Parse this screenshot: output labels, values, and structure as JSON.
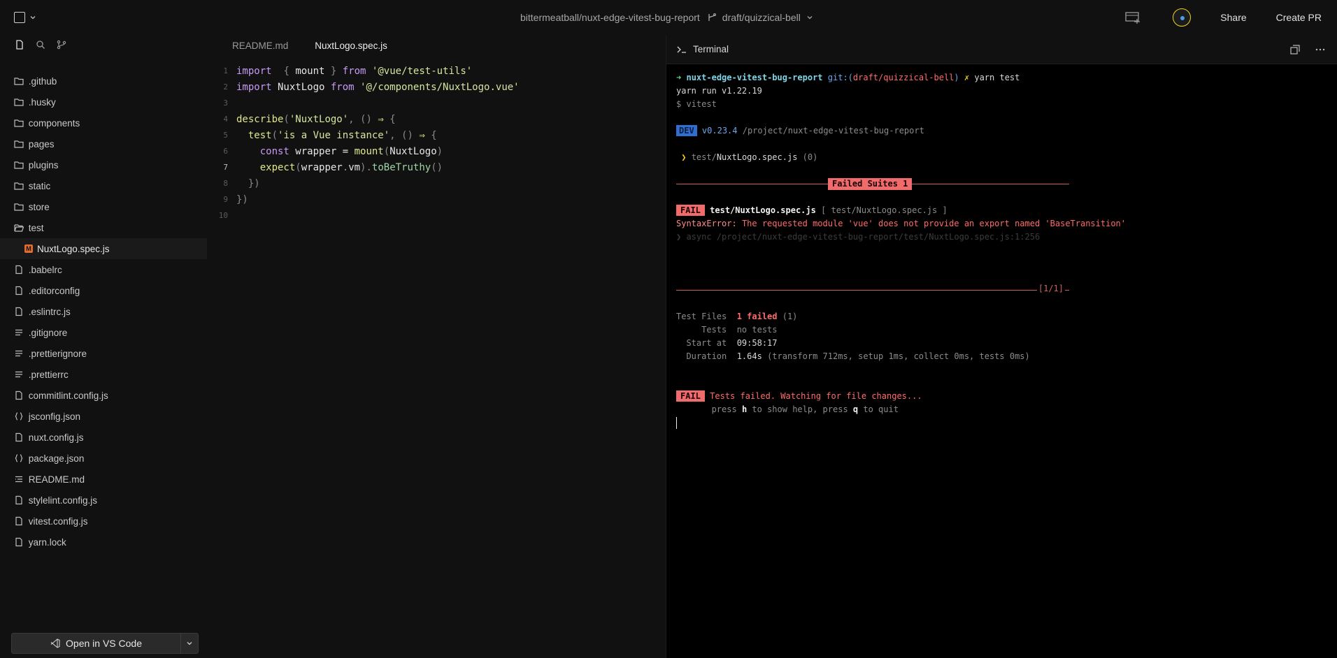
{
  "topbar": {
    "repo": "bittermeatball/nuxt-edge-vitest-bug-report",
    "branch": "draft/quizzical-bell",
    "share": "Share",
    "create_pr": "Create PR"
  },
  "sidebar": {
    "files": [
      {
        "name": ".github",
        "icon": "folder-icon"
      },
      {
        "name": ".husky",
        "icon": "folder-icon"
      },
      {
        "name": "components",
        "icon": "folder-icon"
      },
      {
        "name": "pages",
        "icon": "folder-icon"
      },
      {
        "name": "plugins",
        "icon": "folder-icon"
      },
      {
        "name": "static",
        "icon": "folder-icon"
      },
      {
        "name": "store",
        "icon": "folder-icon"
      },
      {
        "name": "test",
        "icon": "folder-open-icon"
      },
      {
        "name": "NuxtLogo.spec.js",
        "icon": "vue-file-icon"
      },
      {
        "name": ".babelrc",
        "icon": "file-icon"
      },
      {
        "name": ".editorconfig",
        "icon": "file-icon"
      },
      {
        "name": ".eslintrc.js",
        "icon": "file-icon"
      },
      {
        "name": ".gitignore",
        "icon": "lines-icon"
      },
      {
        "name": ".prettierignore",
        "icon": "lines-icon"
      },
      {
        "name": ".prettierrc",
        "icon": "lines-icon"
      },
      {
        "name": "commitlint.config.js",
        "icon": "file-icon"
      },
      {
        "name": "jsconfig.json",
        "icon": "braces-icon"
      },
      {
        "name": "nuxt.config.js",
        "icon": "file-icon"
      },
      {
        "name": "package.json",
        "icon": "braces-icon"
      },
      {
        "name": "README.md",
        "icon": "markdown-icon"
      },
      {
        "name": "stylelint.config.js",
        "icon": "file-icon"
      },
      {
        "name": "vitest.config.js",
        "icon": "file-icon"
      },
      {
        "name": "yarn.lock",
        "icon": "file-icon"
      }
    ],
    "open_vscode": "Open in VS Code"
  },
  "editor": {
    "tabs": [
      "README.md",
      "NuxtLogo.spec.js"
    ],
    "line_numbers": [
      "1",
      "2",
      "3",
      "4",
      "5",
      "6",
      "7",
      "8",
      "9",
      "10"
    ],
    "code": {
      "l1_import": "import",
      "l1_b1": " { ",
      "l1_mount": "mount",
      "l1_b2": " } ",
      "l1_from": "from",
      "l1_src": "'@vue/test-utils'",
      "l2_import": "import",
      "l2_name": " NuxtLogo ",
      "l2_from": "from",
      "l2_src": "'@/components/NuxtLogo.vue'",
      "l4_describe": "describe",
      "l4_p1": "(",
      "l4_str": "'NuxtLogo'",
      "l4_p2": ", () ",
      "l4_arrow": "⇒",
      "l4_p3": " {",
      "l5_test": "test",
      "l5_p1": "(",
      "l5_str": "'is a Vue instance'",
      "l5_p2": ", () ",
      "l5_arrow": "⇒",
      "l5_p3": " {",
      "l6_const": "const",
      "l6_wrapper": " wrapper = ",
      "l6_mount": "mount",
      "l6_p1": "(",
      "l6_arg": "NuxtLogo",
      "l6_p2": ")",
      "l7_expect": "expect",
      "l7_p1": "(",
      "l7_arg": "wrapper",
      "l7_dot": ".",
      "l7_vm": "vm",
      "l7_p2": ").",
      "l7_truthy": "toBeTruthy",
      "l7_p3": "()",
      "l8": "})",
      "l9": "})"
    }
  },
  "terminal": {
    "title": "Terminal",
    "arrow": "➜",
    "cwd": "nuxt-edge-vitest-bug-report",
    "git_label": "git:(",
    "git_branch": "draft/quizzical-bell",
    "git_close": ")",
    "x_mark": "✗",
    "command": "yarn test",
    "yarn_version": "yarn run v1.22.19",
    "vitest_cmd": "$ vitest",
    "dev_badge": "DEV",
    "vitest_version": "v0.23.4",
    "project_path": "/project/nuxt-edge-vitest-bug-report",
    "suite_chev": "❯",
    "suite_dir": "test/",
    "suite_file": "NuxtLogo.spec.js",
    "suite_count": "(0)",
    "failed_suites": "Failed Suites 1",
    "fail_badge": "FAIL",
    "fail_file": "test/NuxtLogo.spec.js",
    "fail_bracket": "[ test/NuxtLogo.spec.js ]",
    "error_type": "SyntaxError:",
    "error_msg": "The requested module 'vue' does not provide an export named 'BaseTransition'",
    "stack_line": "❯ async /project/nuxt-edge-vitest-bug-report/test/NuxtLogo.spec.js:1:256",
    "pager": "[1/1]",
    "summary": {
      "files_label": "Test Files",
      "files_value": "1 failed",
      "files_extra": "(1)",
      "tests_label": "Tests",
      "tests_value": "no tests",
      "start_label": "Start at",
      "start_value": "09:58:17",
      "duration_label": "Duration",
      "duration_value": "1.64s",
      "duration_extra": "(transform 712ms, setup 1ms, collect 0ms, tests 0ms)"
    },
    "final_msg": "Tests failed. Watching for file changes...",
    "help_press1": "press ",
    "help_h": "h",
    "help_mid": " to show help, press ",
    "help_q": "q",
    "help_end": " to quit"
  },
  "colors": {
    "accent_yellow": "#f2d21b",
    "fail_red": "#f06c6c",
    "dev_blue": "#2f6fd0",
    "prompt_green": "#67d77a"
  }
}
